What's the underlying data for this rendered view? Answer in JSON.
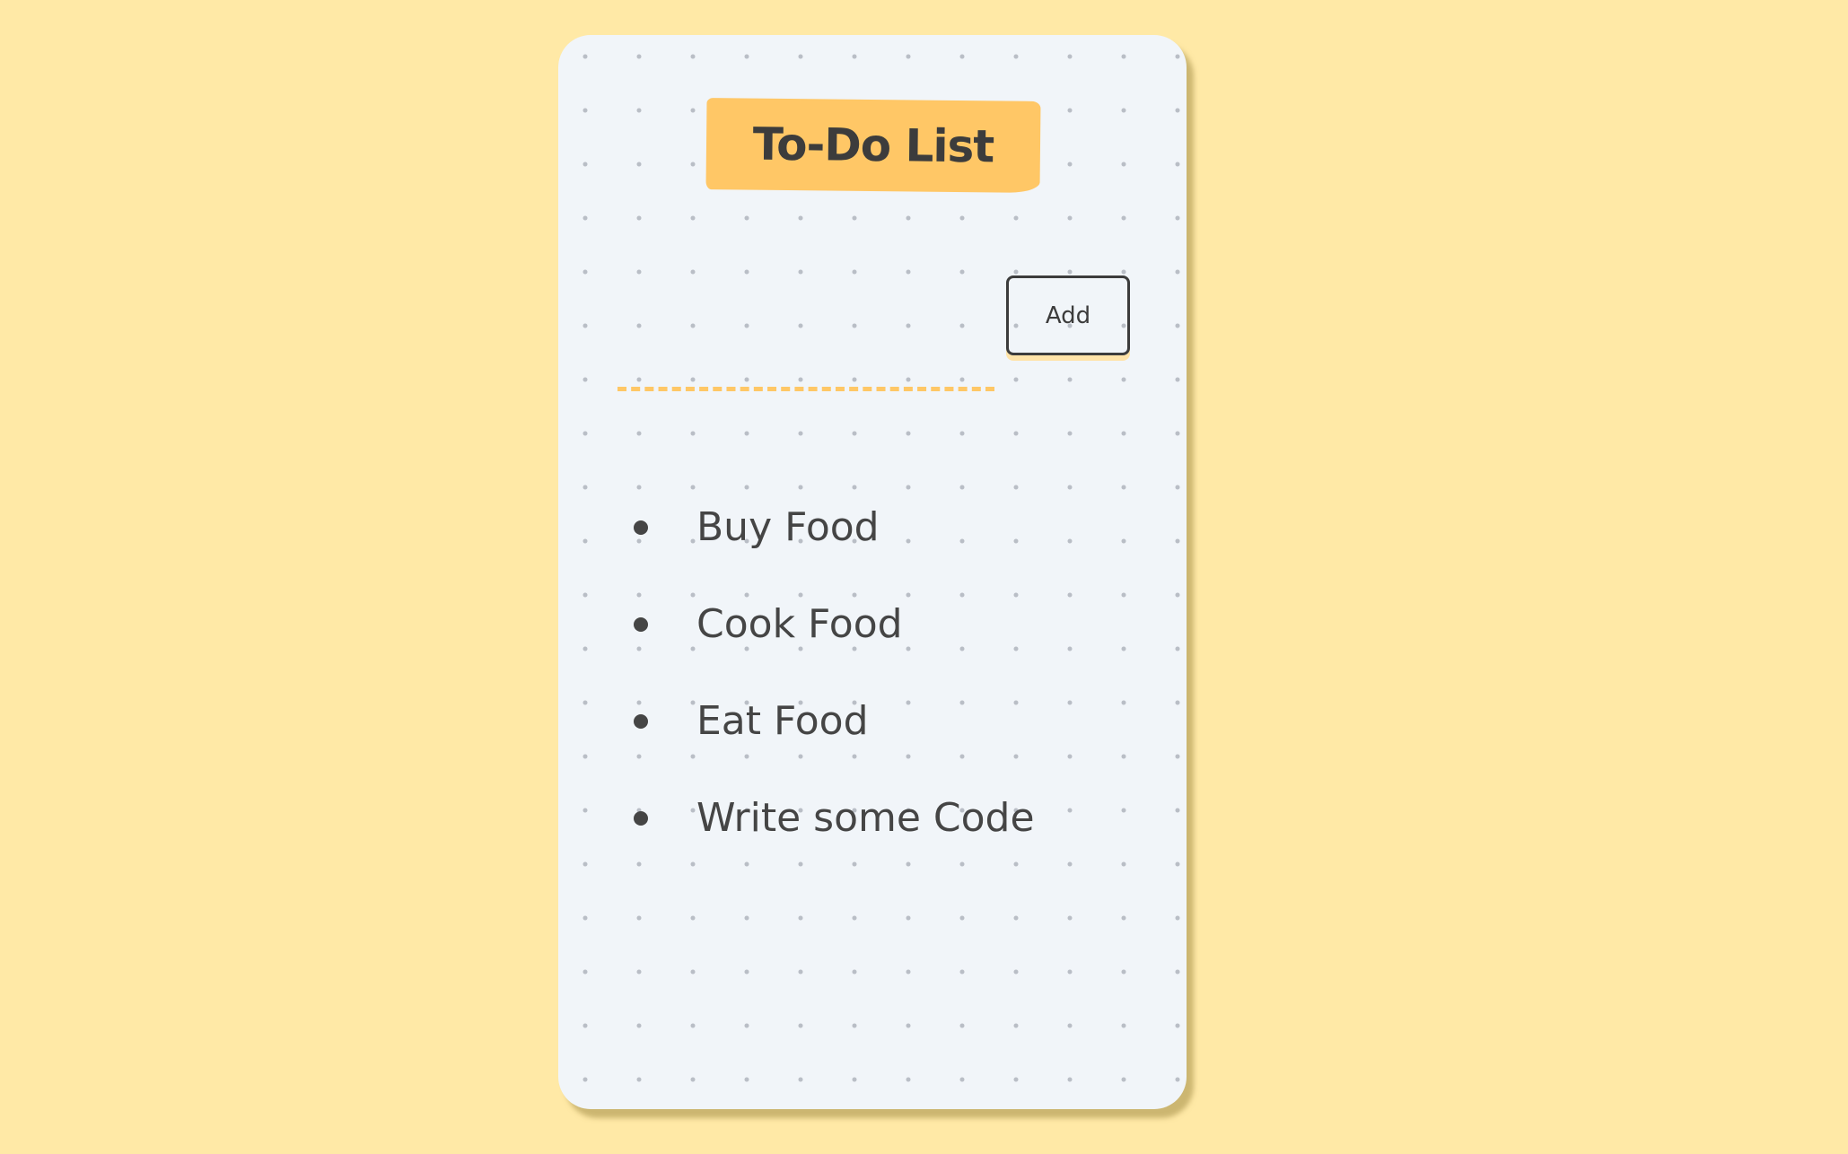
{
  "heading": {
    "title": "To-Do List"
  },
  "input": {
    "value": "",
    "placeholder": ""
  },
  "add_button": {
    "label": "Add"
  },
  "todo_items": [
    {
      "text": "Buy Food"
    },
    {
      "text": "Cook Food"
    },
    {
      "text": "Eat Food"
    },
    {
      "text": "Write some Code"
    }
  ],
  "colors": {
    "page_background": "#ffe9a6",
    "card_background": "#f1f5f9",
    "accent": "#ffc766",
    "text": "#3c3c3c"
  }
}
